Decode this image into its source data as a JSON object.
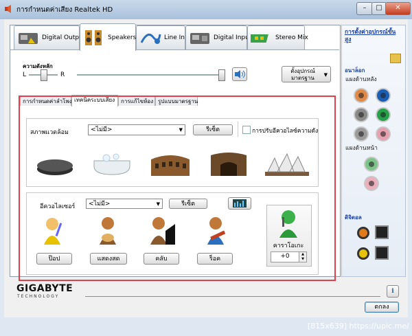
{
  "window": {
    "title": "การกำหนดค่าเสียง Realtek HD",
    "buttons": {
      "minimize": "–",
      "maximize": "□",
      "close": "✕"
    }
  },
  "device_tabs": [
    {
      "label": "Digital Output",
      "icon": "digital-output-icon"
    },
    {
      "label": "Speakers",
      "icon": "speakers-icon"
    },
    {
      "label": "Line In",
      "icon": "line-in-icon"
    },
    {
      "label": "Digital Input",
      "icon": "digital-input-icon"
    },
    {
      "label": "Stereo Mix",
      "icon": "stereo-mix-icon"
    }
  ],
  "volume": {
    "label": "ความดังหลัก",
    "left": "L",
    "right": "R",
    "balance": 0.5,
    "level": 1.0,
    "default_device_button": "ตั้งอุปกรณ์มาตรฐาน"
  },
  "sub_tabs": [
    "การกำหนดค่าลำโพง",
    "เทคนิคระบบเสียง",
    "การแก้ไขห้อง",
    "รูปแบบมาตรฐาน"
  ],
  "environment": {
    "label": "สภาพแวดล้อม",
    "selected": "<ไม่มี>",
    "reset_button": "รีเซ็ต",
    "loudness_checkbox": "การปรับอีควอไลซ์ความดัง",
    "loudness_checked": false,
    "scenes": [
      "stone-icon",
      "bathtub-icon",
      "colosseum-icon",
      "cave-icon",
      "opera-house-icon"
    ]
  },
  "equalizer": {
    "label": "อีควอไลเซอร์",
    "selected": "<ไม่มี>",
    "reset_button": "รีเซ็ต",
    "presets": [
      {
        "label": "ป๊อป",
        "icon": "pop-singer-icon"
      },
      {
        "label": "แสดงสด",
        "icon": "live-guitarist-icon"
      },
      {
        "label": "คลับ",
        "icon": "club-pianist-icon"
      },
      {
        "label": "ร็อค",
        "icon": "rock-guitarist-icon"
      }
    ]
  },
  "karaoke": {
    "label": "คาราโอเกะ",
    "value": "+0"
  },
  "sidebar": {
    "advanced_link": "การตั้งค่าอุปกรณ์ขั้นสูง",
    "analog_title": "อนาล็อก",
    "rear_panel": "แผงด้านหลัง",
    "front_panel": "แผงด้านหน้า",
    "digital_title": "ดิจิตอล",
    "colors": {
      "orange": "#e08a4a",
      "blue": "#1a5fb4",
      "gray": "#8a8a8a",
      "green": "#27a04a",
      "pink": "#e6a0b0"
    }
  },
  "footer": {
    "brand": "GIGABYTE",
    "brand_sub": "TECHNOLOGY",
    "ok_button": "ตกลง",
    "info_icon": "i"
  },
  "watermark": "[815x639] https://upic.me/"
}
